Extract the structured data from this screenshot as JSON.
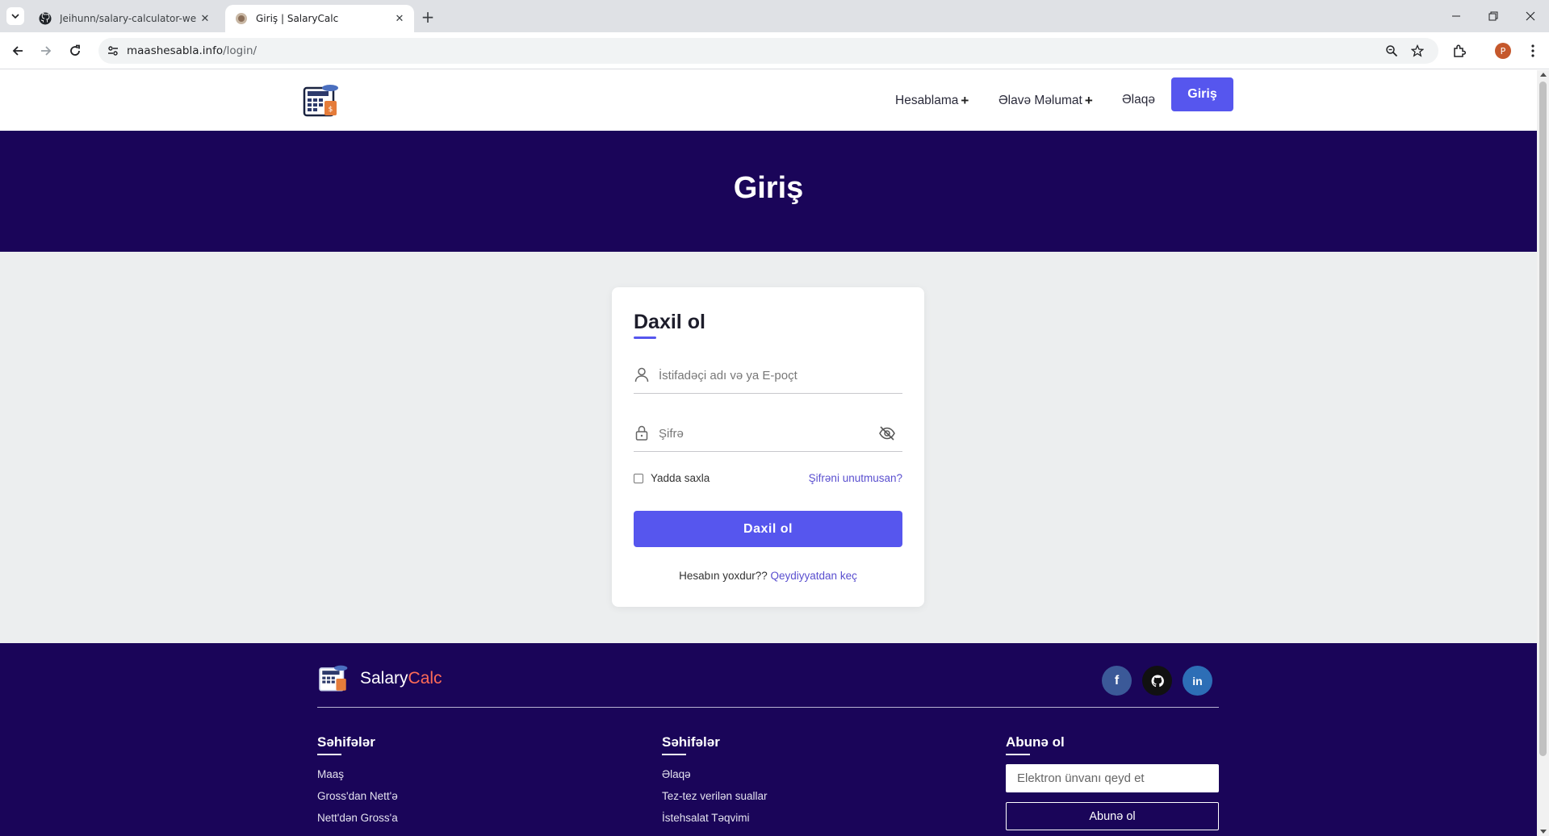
{
  "browser": {
    "tabs": [
      {
        "title": "Jeihunn/salary-calculator-web",
        "icon": "github-icon",
        "active": false
      },
      {
        "title": "Giriş | SalaryCalc",
        "icon": "site-favicon",
        "active": true
      }
    ],
    "url_host": "maashesabla.info",
    "url_path": "/login/",
    "profile_initial": "P"
  },
  "header": {
    "nav": {
      "calc": "Hesablama",
      "more_info": "Əlavə Məlumat",
      "contact": "Əlaqə"
    },
    "login_button": "Giriş"
  },
  "hero": {
    "title": "Giriş"
  },
  "login_form": {
    "title": "Daxil ol",
    "username_placeholder": "İstifadəçi adı və ya E-poçt",
    "password_placeholder": "Şifrə",
    "remember_label": "Yadda saxla",
    "forgot_link": "Şifrəni unutmusan?",
    "submit_label": "Daxil ol",
    "no_account_text": "Hesabın yoxdur??",
    "register_link": "Qeydiyyatdan keç"
  },
  "footer": {
    "brand_salary": "Salary",
    "brand_calc": "Calc",
    "social": {
      "facebook": "f",
      "linkedin": "in"
    },
    "col1": {
      "title": "Səhifələr",
      "links": [
        "Maaş",
        "Gross'dan Nett'ə",
        "Nett'dən Gross'a"
      ]
    },
    "col2": {
      "title": "Səhifələr",
      "links": [
        "Əlaqə",
        "Tez-tez verilən suallar",
        "İstehsalat Təqvimi"
      ]
    },
    "col3": {
      "title": "Abunə ol",
      "email_placeholder": "Elektron ünvanı qeyd et",
      "button": "Abunə ol"
    }
  },
  "colors": {
    "primary": "#5656ee",
    "hero_bg": "#1a0559",
    "link": "#5a4fcf",
    "brand_accent": "#ff6b57"
  }
}
